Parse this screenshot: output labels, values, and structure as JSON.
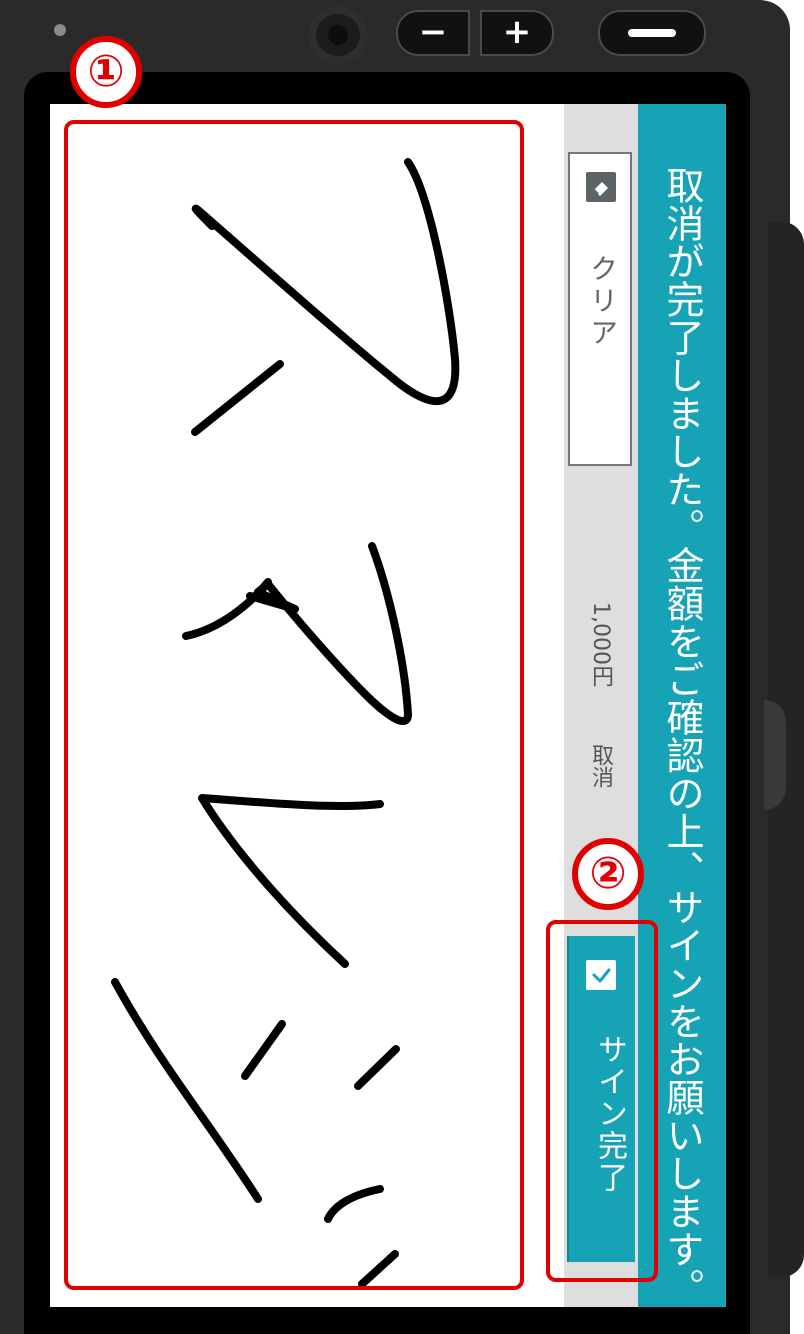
{
  "device": {
    "hw_minus_label": "−",
    "hw_plus_label": "+"
  },
  "status": {
    "message": "取消が完了しました。金額をご確認の上、サインをお願いします。"
  },
  "controls": {
    "clear_label": "クリア",
    "amount": "1,000円",
    "transaction_type": "取消",
    "done_label": "サイン完了"
  },
  "annotations": {
    "marker_1": "①",
    "marker_2": "②"
  },
  "colors": {
    "accent": "#17a3b6",
    "annotation": "#e00000",
    "strip": "#dedede"
  },
  "icons": [
    "eraser-icon",
    "check-icon"
  ]
}
